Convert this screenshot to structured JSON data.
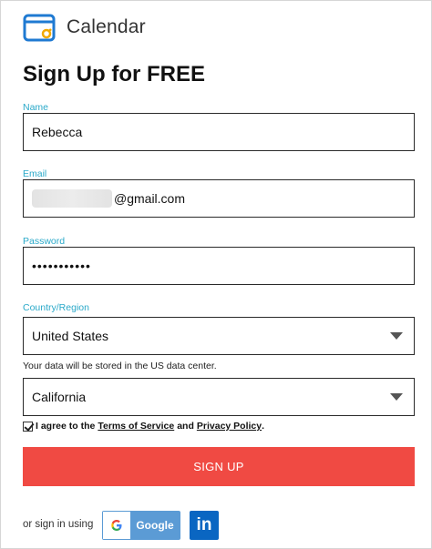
{
  "header": {
    "brand": "Calendar",
    "logo_icon": "calendar-logo-icon"
  },
  "form": {
    "title": "Sign Up for FREE",
    "name": {
      "label": "Name",
      "value": "Rebecca"
    },
    "email": {
      "label": "Email",
      "value_suffix": "@gmail.com"
    },
    "password": {
      "label": "Password",
      "value": "•••••••••••"
    },
    "country": {
      "label": "Country/Region",
      "value": "United States"
    },
    "storage_note": "Your data will be stored in the US data center.",
    "state": {
      "value": "California"
    },
    "agree": {
      "prefix": "I agree to the",
      "terms": "Terms of Service",
      "and": "and",
      "privacy": "Privacy Policy",
      "suffix": "."
    },
    "signup_label": "SIGN UP"
  },
  "social": {
    "prefix": "or sign in using",
    "google_label": "Google",
    "linkedin_label": "in"
  },
  "colors": {
    "accent": "#f04a43",
    "label": "#2aa9c9",
    "google": "#5b9bd5",
    "linkedin": "#0a66c2"
  }
}
